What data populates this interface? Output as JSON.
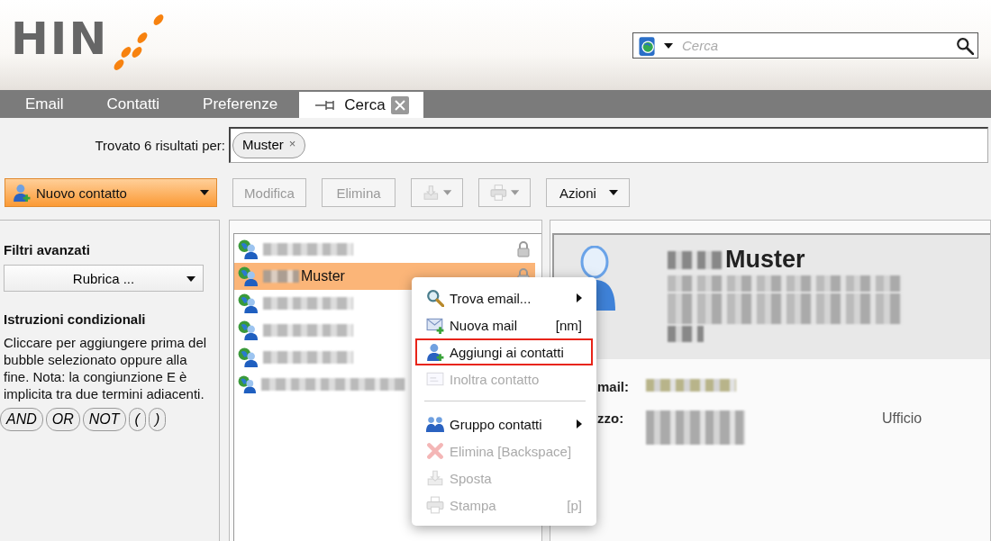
{
  "header": {
    "logo": "HIN",
    "search": {
      "placeholder": "Cerca"
    }
  },
  "tabs": [
    {
      "label": "Email",
      "selected": false
    },
    {
      "label": "Contatti",
      "selected": false
    },
    {
      "label": "Preferenze",
      "selected": false
    },
    {
      "label": "Cerca",
      "selected": true
    }
  ],
  "results": {
    "label": "Trovato 6 risultati per:",
    "chips": [
      {
        "label": "Muster",
        "remove": "×"
      }
    ]
  },
  "toolbar": [
    {
      "kind": "primary",
      "label": "Nuovo contatto",
      "disabled": false
    },
    {
      "kind": "text",
      "label": "Modifica",
      "disabled": true
    },
    {
      "kind": "text",
      "label": "Elimina",
      "disabled": true
    },
    {
      "kind": "move",
      "disabled": true
    },
    {
      "kind": "print",
      "disabled": true
    },
    {
      "kind": "menu",
      "label": "Azioni",
      "disabled": false
    }
  ],
  "sidebar": {
    "filters_title": "Filtri avanzati",
    "address_book": "Rubrica ...",
    "conditions_title": "Istruzioni condizionali",
    "conditions_text": "Cliccare per aggiungere prima del bubble selezionato oppure alla fine. Nota: la congiunzione E è implicita tra due termini adiacenti.",
    "operators": [
      "AND",
      "OR",
      "NOT",
      "(",
      ")"
    ]
  },
  "contacts": [
    {
      "selected": false,
      "locked": true
    },
    {
      "name": "Muster",
      "selected": true,
      "locked": true
    },
    {
      "selected": false,
      "locked": false
    },
    {
      "selected": false,
      "locked": false
    },
    {
      "selected": false,
      "locked": false
    },
    {
      "selected": false,
      "locked": false
    }
  ],
  "detail": {
    "name": "Muster",
    "fields": [
      {
        "label": "mail:"
      },
      {
        "label": "zzo:",
        "note": "Ufficio"
      }
    ]
  },
  "context_menu": [
    {
      "kind": "item",
      "label": "Trova email...",
      "submenu": true,
      "disabled": false,
      "outlined": false
    },
    {
      "kind": "item",
      "label": "Nuova mail",
      "shortcut": "[nm]",
      "submenu": false,
      "disabled": false,
      "outlined": false
    },
    {
      "kind": "item",
      "label": "Aggiungi ai contatti",
      "submenu": false,
      "disabled": false,
      "outlined": true
    },
    {
      "kind": "item",
      "label": "Inoltra contatto",
      "submenu": false,
      "disabled": true,
      "outlined": false
    },
    {
      "kind": "separator"
    },
    {
      "kind": "item",
      "label": "Gruppo contatti",
      "submenu": true,
      "disabled": false,
      "outlined": false
    },
    {
      "kind": "item",
      "label": "Elimina [Backspace]",
      "submenu": false,
      "disabled": true,
      "outlined": false
    },
    {
      "kind": "item",
      "label": "Sposta",
      "submenu": false,
      "disabled": true,
      "outlined": false
    },
    {
      "kind": "item",
      "label": "Stampa",
      "shortcut": "[p]",
      "submenu": false,
      "disabled": true,
      "outlined": false
    }
  ]
}
